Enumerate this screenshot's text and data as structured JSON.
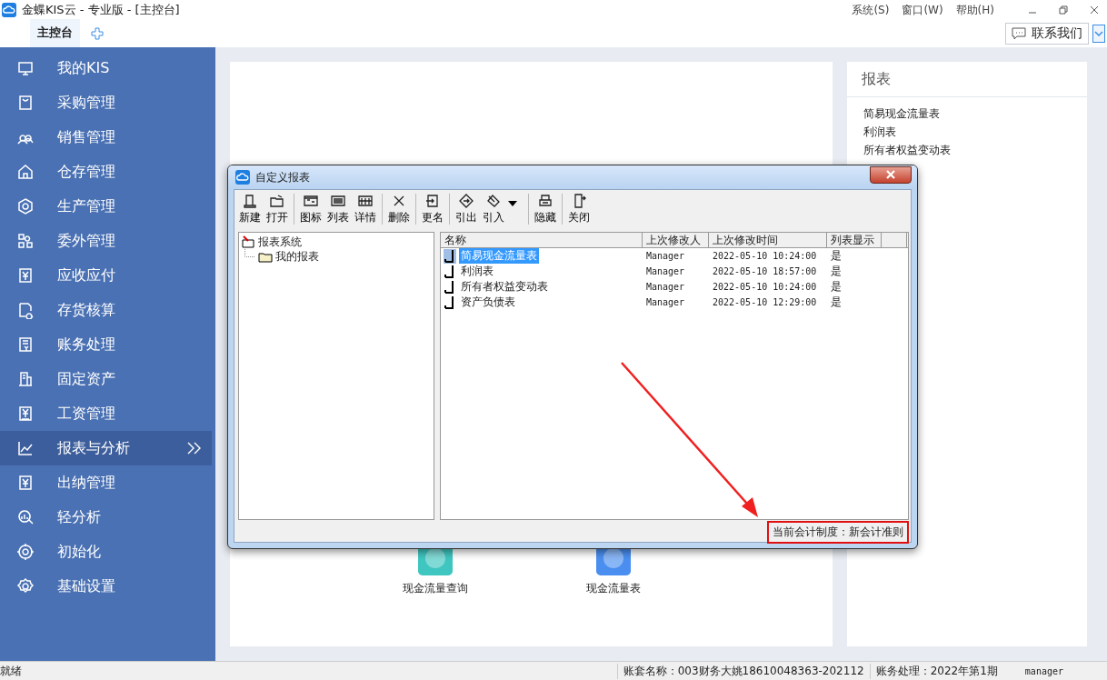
{
  "window": {
    "title": "金蝶KIS云 - 专业版 - [主控台]",
    "menu": [
      "系统(S)",
      "窗口(W)",
      "帮助(H)"
    ]
  },
  "tabs": [
    {
      "label": "主控台",
      "selected": true
    }
  ],
  "contact_button": "联系我们",
  "sidebar": {
    "items": [
      {
        "label": "我的KIS",
        "selected": false
      },
      {
        "label": "采购管理",
        "selected": false
      },
      {
        "label": "销售管理",
        "selected": false
      },
      {
        "label": "仓存管理",
        "selected": false
      },
      {
        "label": "生产管理",
        "selected": false
      },
      {
        "label": "委外管理",
        "selected": false
      },
      {
        "label": "应收应付",
        "selected": false
      },
      {
        "label": "存货核算",
        "selected": false
      },
      {
        "label": "账务处理",
        "selected": false
      },
      {
        "label": "固定资产",
        "selected": false
      },
      {
        "label": "工资管理",
        "selected": false
      },
      {
        "label": "报表与分析",
        "selected": true
      },
      {
        "label": "出纳管理",
        "selected": false
      },
      {
        "label": "轻分析",
        "selected": false
      },
      {
        "label": "初始化",
        "selected": false
      },
      {
        "label": "基础设置",
        "selected": false
      }
    ]
  },
  "tiles": [
    {
      "label": "现金流量查询",
      "color": "#3fc6c0"
    },
    {
      "label": "现金流量表",
      "color": "#4a8ff0"
    }
  ],
  "report_panel": {
    "title": "报表",
    "links": [
      "简易现金流量表",
      "利润表",
      "所有者权益变动表"
    ]
  },
  "dialog": {
    "title": "自定义报表",
    "toolbar_groups": [
      [
        {
          "label": "新建",
          "dropdown": false
        },
        {
          "label": "打开",
          "dropdown": false
        }
      ],
      [
        {
          "label": "图标",
          "dropdown": false
        },
        {
          "label": "列表",
          "dropdown": false
        },
        {
          "label": "详情",
          "dropdown": false
        }
      ],
      [
        {
          "label": "删除",
          "dropdown": false
        }
      ],
      [
        {
          "label": "更名",
          "dropdown": false
        }
      ],
      [
        {
          "label": "引出",
          "dropdown": false
        },
        {
          "label": "引入",
          "dropdown": true
        }
      ],
      [
        {
          "label": "隐藏",
          "dropdown": false
        }
      ],
      [
        {
          "label": "关闭",
          "dropdown": false
        }
      ]
    ],
    "tree": {
      "label": "报表系统",
      "expanded": true,
      "children": [
        {
          "label": "我的报表"
        }
      ]
    },
    "columns": [
      "名称",
      "上次修改人",
      "上次修改时间",
      "列表显示"
    ],
    "rows": [
      {
        "name": "简易现金流量表",
        "modified_by": "Manager",
        "modified_at": "2022-05-10 10:24:00",
        "shown": "是",
        "selected": true
      },
      {
        "name": "利润表",
        "modified_by": "Manager",
        "modified_at": "2022-05-10 18:57:00",
        "shown": "是",
        "selected": false
      },
      {
        "name": "所有者权益变动表",
        "modified_by": "Manager",
        "modified_at": "2022-05-10 10:24:00",
        "shown": "是",
        "selected": false
      },
      {
        "name": "资产负债表",
        "modified_by": "Manager",
        "modified_at": "2022-05-10 12:29:00",
        "shown": "是",
        "selected": false
      }
    ],
    "status": {
      "text": "当前会计制度：新会计准则",
      "highlighted": true
    }
  },
  "status_bar": [
    "就绪",
    "账套名称：003财务大姚18610048363-202112",
    "账务处理：2022年第1期",
    "manager"
  ]
}
